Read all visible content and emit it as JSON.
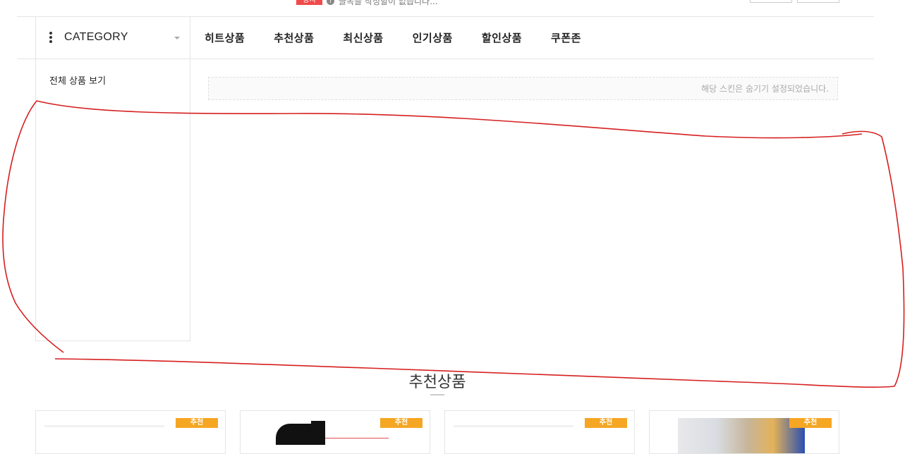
{
  "top_bar": {
    "notice_badge": "공지",
    "notice_icon": "info-icon",
    "notice_text": "글목을 작성할이 없습니다..."
  },
  "nav": {
    "category_label": "CATEGORY",
    "menu_items": [
      "히트상품",
      "추천상품",
      "최신상품",
      "인기상품",
      "할인상품",
      "쿠폰존"
    ]
  },
  "sidebar": {
    "all_products_link": "전체 상품 보기"
  },
  "main": {
    "hidden_skin_notice": "해당 스킨은 숨기기 설정되었습니다."
  },
  "recommended": {
    "title": "추천상품",
    "badges": [
      "추천",
      "추천",
      "추천",
      "추천"
    ]
  },
  "colors": {
    "notice_badge": "#f04a4a",
    "product_badge": "#f5a623",
    "annotation": "#d61f1f"
  }
}
